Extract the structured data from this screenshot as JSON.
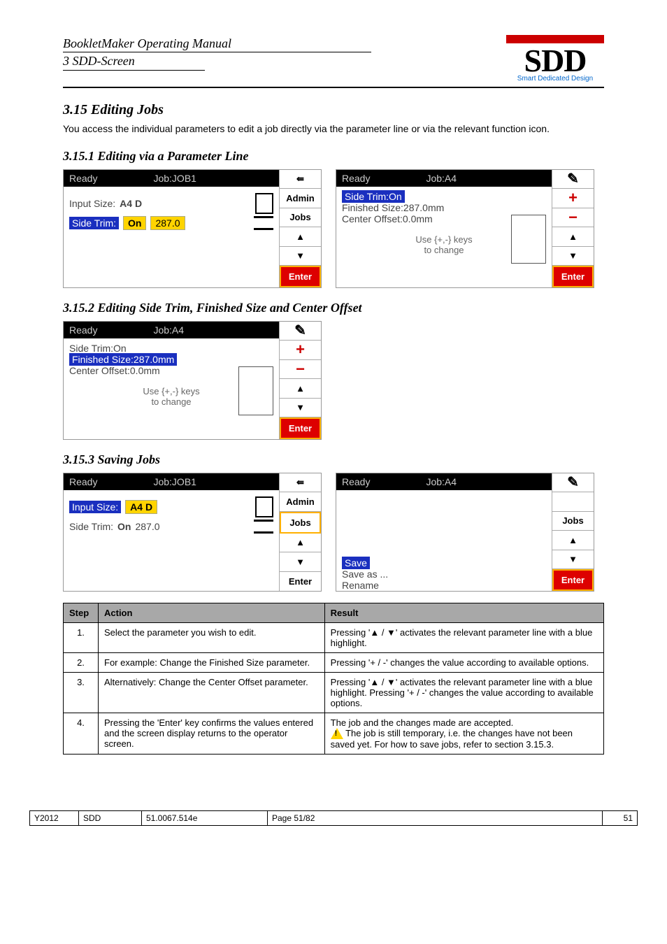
{
  "header": {
    "line1": "BookletMaker Operating Manual",
    "line2": "3 SDD-Screen"
  },
  "logo": {
    "name": "SDD",
    "tagline": "Smart Dedicated Design"
  },
  "section_title": "3.15 Editing Jobs",
  "section_intro": "You access the individual parameters to edit a job directly via the parameter line or via the relevant function icon.",
  "sub1_title": "3.15.1 Editing via a Parameter Line",
  "sub2_title": "3.15.2 Editing Side Trim, Finished Size and Center Offset",
  "sub3_title": "3.15.3 Saving Jobs",
  "screen_a": {
    "status": "Ready",
    "job": "Job:JOB1",
    "input_size_label": "Input Size:",
    "input_size_value": "A4 D",
    "side_trim_label": "Side Trim:",
    "side_trim_on": "On",
    "side_trim_val": "287.0",
    "side": {
      "admin": "Admin",
      "jobs": "Jobs",
      "enter": "Enter"
    }
  },
  "screen_b": {
    "status": "Ready",
    "job": "Job:A4",
    "l1": "Side Trim:On",
    "l2": "Finished Size:287.0mm",
    "l3": "Center Offset:0.0mm",
    "msg1": "Use {+,-} keys",
    "msg2": "to change",
    "side": {
      "enter": "Enter"
    }
  },
  "screen_c": {
    "status": "Ready",
    "job": "Job:A4",
    "l1": "Side Trim:On",
    "l2": "Finished Size:287.0mm",
    "l3": "Center Offset:0.0mm",
    "msg1": "Use {+,-} keys",
    "msg2": "to change",
    "side": {
      "enter": "Enter"
    }
  },
  "screen_d": {
    "status": "Ready",
    "job": "Job:JOB1",
    "input_size_label": "Input Size:",
    "input_size_value": "A4 D",
    "side_trim_label": "Side Trim:",
    "side_trim_on": "On",
    "side_trim_val": "287.0",
    "side": {
      "admin": "Admin",
      "jobs": "Jobs",
      "enter": "Enter"
    }
  },
  "screen_e": {
    "status": "Ready",
    "job": "Job:A4",
    "opt1": "Save",
    "opt2": "Save as ...",
    "opt3": "Rename",
    "side": {
      "jobs": "Jobs",
      "enter": "Enter"
    }
  },
  "steps_table": {
    "h1": "Step",
    "h2": "Action",
    "h3": "Result",
    "rows": [
      {
        "step": "1.",
        "action": "Select the parameter you wish to edit.",
        "result": "Pressing '▲ / ▼' activates the relevant parameter line with a blue highlight."
      },
      {
        "step": "2.",
        "action": "For example: Change the Finished Size parameter.",
        "result": "Pressing '+ / -' changes the value according to available options."
      },
      {
        "step": "3.",
        "action": "Alternatively: Change the Center Offset parameter.",
        "result": "Pressing '▲ / ▼' activates the relevant parameter line with a blue highlight. Pressing '+ / -' changes the value according to available options."
      },
      {
        "step": "4.",
        "action": "Pressing the 'Enter' key confirms the values entered and the screen display returns to the operator screen.",
        "result_line1": "The job and the changes made are accepted.",
        "result_line2": " The job is still temporary, i.e. the changes have not been saved yet. For how to save jobs, refer to section 3.15.3."
      }
    ]
  },
  "footer": {
    "c1": "Y2012",
    "c2": "SDD",
    "c3": "51.0067.514e",
    "c4": "Page 51/82",
    "c5": "51"
  }
}
